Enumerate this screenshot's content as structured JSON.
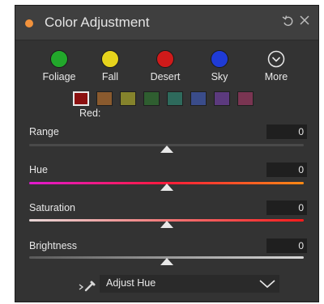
{
  "panel": {
    "title": "Color Adjustment",
    "reset_icon": "undo-icon",
    "close_icon": "close-icon",
    "accent": "#f2923c"
  },
  "presets": [
    {
      "label": "Foliage",
      "color": "#22a82b"
    },
    {
      "label": "Fall",
      "color": "#e6d31c"
    },
    {
      "label": "Desert",
      "color": "#cf1a1a"
    },
    {
      "label": "Sky",
      "color": "#1f3bd6"
    },
    {
      "label": "More",
      "icon": "chevron-circle-down-icon"
    }
  ],
  "swatches": {
    "colors": [
      "#8b1010",
      "#8a5a2e",
      "#85832c",
      "#2f5e30",
      "#2e6a5c",
      "#3a4c8a",
      "#5c3a7e",
      "#7a3552"
    ],
    "selected_index": 0,
    "selected_label": "Red:"
  },
  "sliders": {
    "range": {
      "label": "Range",
      "value": "0",
      "level": 0.5
    },
    "hue": {
      "label": "Hue",
      "value": "0",
      "level": 0.5
    },
    "saturation": {
      "label": "Saturation",
      "value": "0",
      "level": 0.5
    },
    "brightness": {
      "label": "Brightness",
      "value": "0",
      "level": 0.5
    }
  },
  "tool": {
    "picker_icon": "eyedropper-icon",
    "selected": "Adjust Hue",
    "chevron_icon": "chevron-down-icon"
  }
}
